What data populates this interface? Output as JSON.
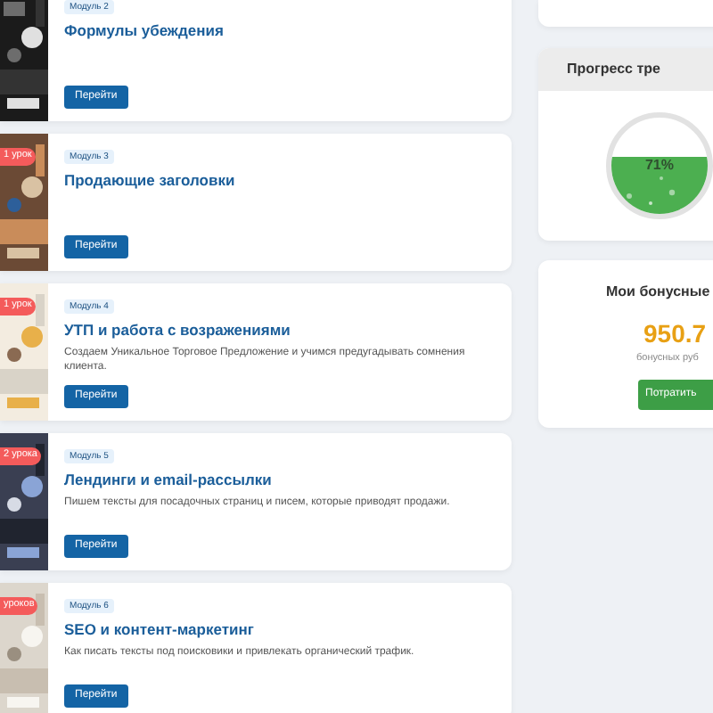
{
  "modules": [
    {
      "tag": "Модуль 2",
      "title": "Формулы убеждения",
      "button": "Перейти"
    },
    {
      "lessons": "1 урок",
      "tag": "Модуль 3",
      "title": "Продающие заголовки",
      "button": "Перейти"
    },
    {
      "lessons": "1 урок",
      "tag": "Модуль 4",
      "title": "УТП и работа с возражениями",
      "description": "Создаем Уникальное Торговое Предложение и учимся предугадывать сомнения клиента.",
      "button": "Перейти"
    },
    {
      "lessons": "2 урока",
      "tag": "Модуль 5",
      "title": "Лендинги и email-рассылки",
      "description": "Пишем тексты для посадочных страниц и писем, которые приводят продажи.",
      "button": "Перейти"
    },
    {
      "lessons": "уроков",
      "tag": "Модуль 6",
      "title": "SEO и контент-маркетинг",
      "description": "Как писать тексты под поисковики и привлекать органический трафик.",
      "button": "Перейти"
    }
  ],
  "progress": {
    "title": "Прогресс тре",
    "reading": "71%"
  },
  "bonus": {
    "title": "Мои бонусные",
    "amount": "950.7",
    "unit": "бонусных руб",
    "button": "Потратить"
  }
}
